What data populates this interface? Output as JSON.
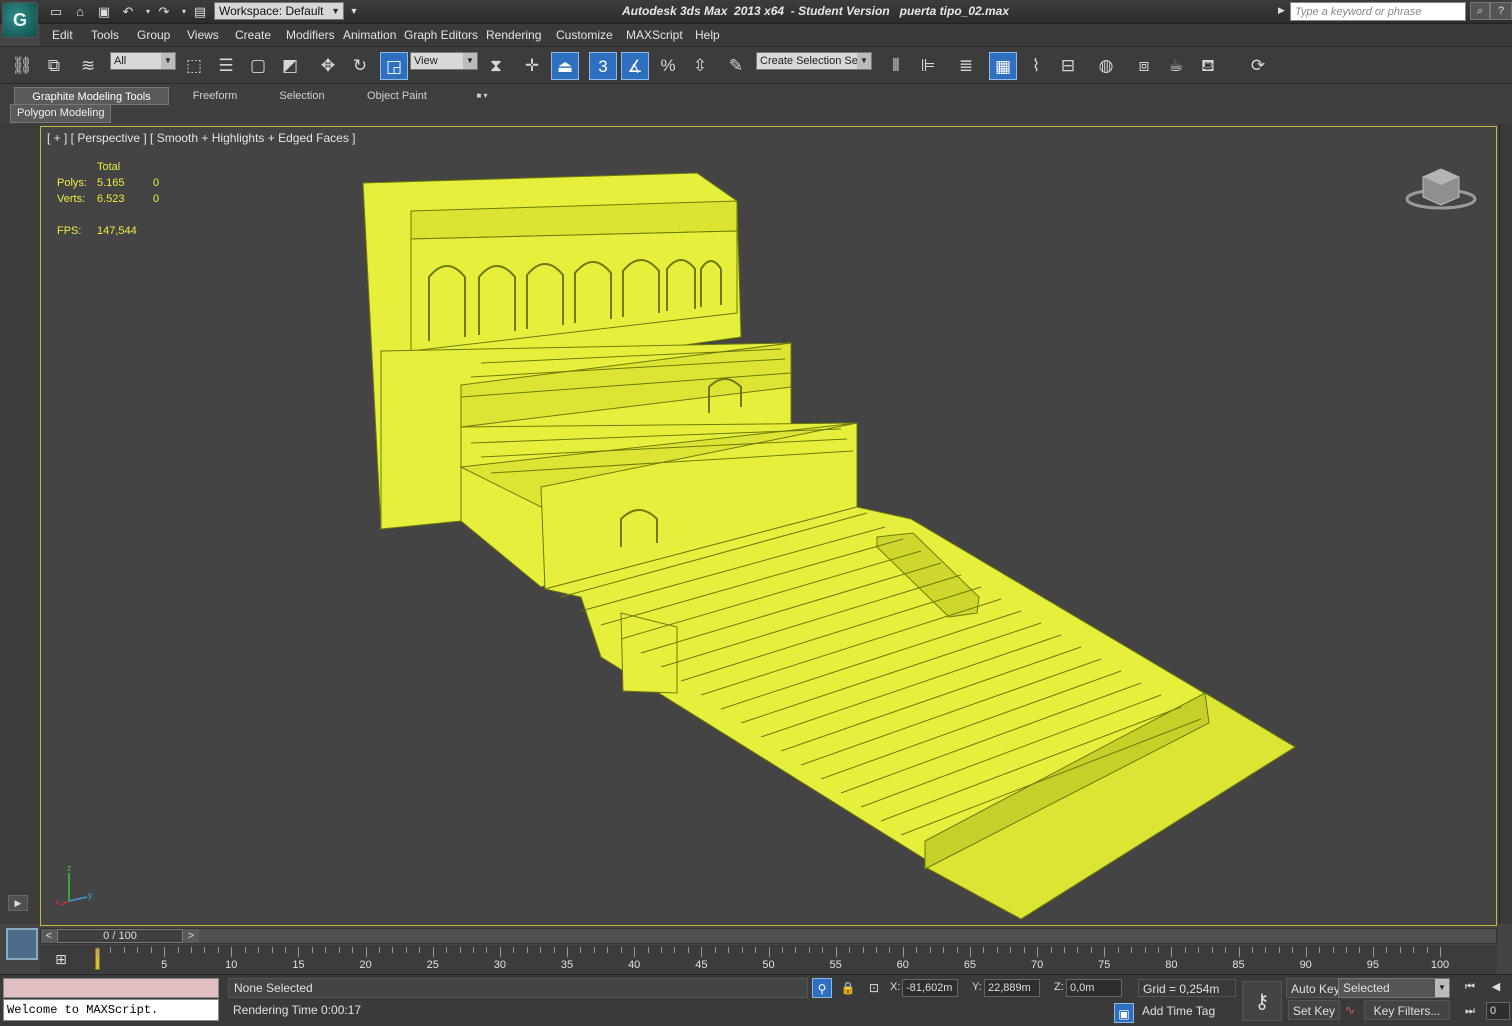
{
  "title_bar": {
    "app_title": "Autodesk 3ds Max  2013 x64  - Student Version   puerta tipo_02.max",
    "workspace_label": "Workspace: Default",
    "search_placeholder": "Type a keyword or phrase",
    "quick_access_icons": [
      "new-file-icon",
      "open-file-icon",
      "save-icon",
      "undo-icon",
      "redo-icon",
      "project-folder-icon"
    ]
  },
  "menu": {
    "items": [
      "Edit",
      "Tools",
      "Group",
      "Views",
      "Create",
      "Modifiers",
      "Animation",
      "Graph Editors",
      "Rendering",
      "Customize",
      "MAXScript",
      "Help"
    ]
  },
  "toolbar": {
    "selection_filter": "All",
    "reference_coord": "View",
    "named_selection": "Create Selection Se",
    "snap_toggle_label": "3",
    "active_tools": [
      "select-and-scale",
      "use-pivot-center",
      "snaps-toggle",
      "angle-snap",
      "graphite-toggle"
    ]
  },
  "ribbon": {
    "tabs": [
      "Graphite Modeling Tools",
      "Freeform",
      "Selection",
      "Object Paint"
    ],
    "active_tab": "Graphite Modeling Tools",
    "subpanel": "Polygon Modeling"
  },
  "viewport": {
    "label": "[ + ] [ Perspective ] [ Smooth + Highlights + Edged Faces ]",
    "stats": {
      "header": "Total",
      "polys_label": "Polys:",
      "polys_value": "5.165",
      "polys_selected": "0",
      "verts_label": "Verts:",
      "verts_value": "6.523",
      "verts_selected": "0",
      "fps_label": "FPS:",
      "fps_value": "147,544"
    },
    "axis_labels": {
      "x": "x",
      "y": "y",
      "z": "z"
    },
    "object_color": "#e6f03c",
    "border_color": "#c7b73e"
  },
  "timeline": {
    "slider_label": "0 / 100",
    "ticks": [
      "5",
      "10",
      "15",
      "20",
      "25",
      "30",
      "35",
      "40",
      "45",
      "50",
      "55",
      "60",
      "65",
      "70",
      "75",
      "80",
      "85",
      "90",
      "95",
      "100"
    ],
    "current_frame": 0,
    "total_frames": 100
  },
  "status": {
    "maxscript_text": "Welcome to MAXScript.",
    "selection_status": "None Selected",
    "rendering_time": "Rendering Time  0:00:17",
    "x_label": "X:",
    "x_value": "-81,602m",
    "y_label": "Y:",
    "y_value": "22,889m",
    "z_label": "Z:",
    "z_value": "0,0m",
    "grid": "Grid = 0,254m",
    "add_time_tag": "Add Time Tag",
    "auto_key": "Auto Key",
    "set_key": "Set Key",
    "key_mode": "Selected",
    "key_filters": "Key Filters...",
    "frame_value": "0"
  }
}
